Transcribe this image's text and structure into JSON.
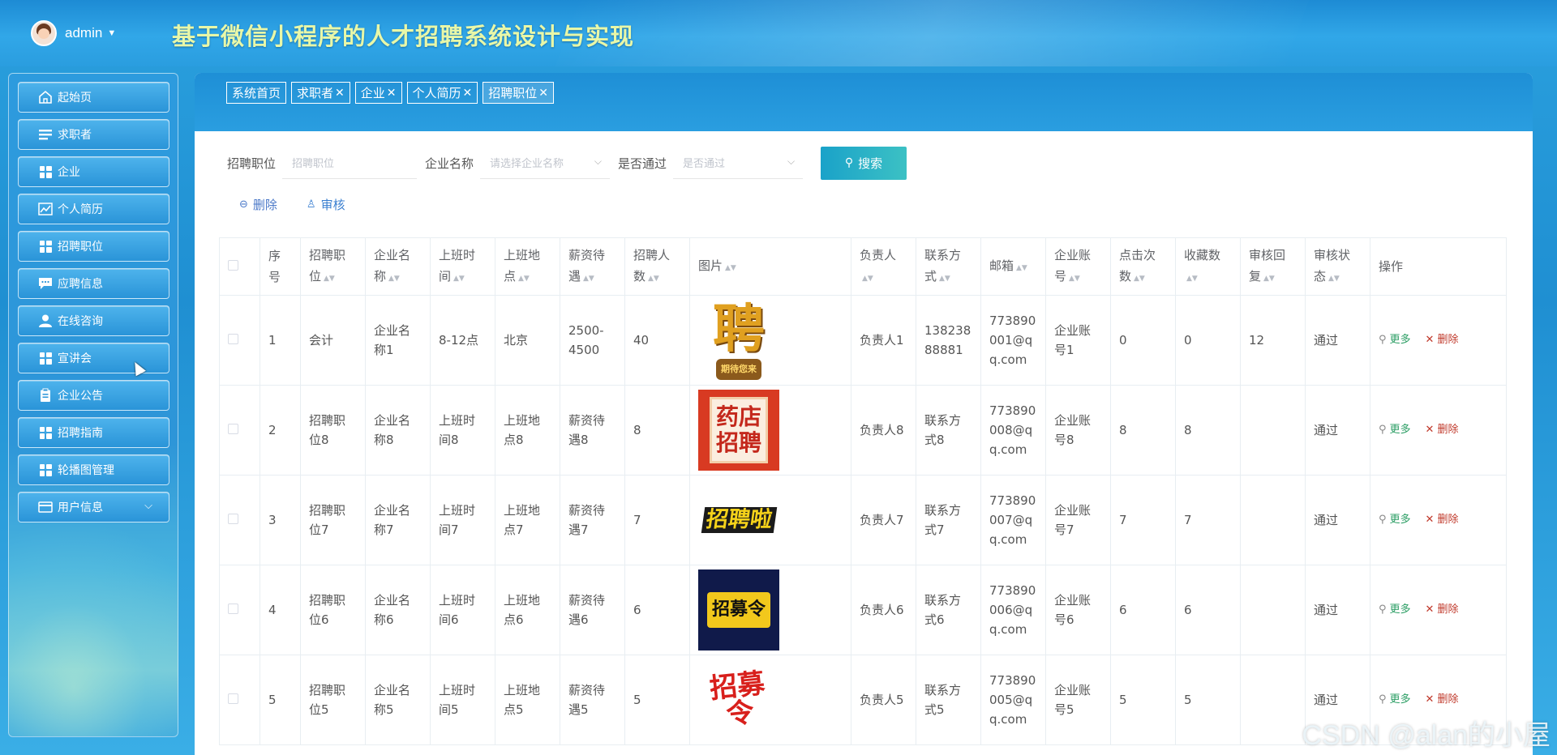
{
  "header": {
    "username": "admin",
    "title": "基于微信小程序的人才招聘系统设计与实现"
  },
  "sidebar": {
    "items": [
      {
        "label": "起始页",
        "icon": "home-icon"
      },
      {
        "label": "求职者",
        "icon": "list-icon"
      },
      {
        "label": "企业",
        "icon": "grid-icon"
      },
      {
        "label": "个人简历",
        "icon": "chart-icon"
      },
      {
        "label": "招聘职位",
        "icon": "grid-icon"
      },
      {
        "label": "应聘信息",
        "icon": "chat-icon"
      },
      {
        "label": "在线咨询",
        "icon": "user-icon"
      },
      {
        "label": "宣讲会",
        "icon": "grid-icon"
      },
      {
        "label": "企业公告",
        "icon": "clipboard-icon"
      },
      {
        "label": "招聘指南",
        "icon": "grid-icon"
      },
      {
        "label": "轮播图管理",
        "icon": "grid-icon"
      },
      {
        "label": "用户信息",
        "icon": "card-icon"
      }
    ]
  },
  "tabs": [
    {
      "label": "系统首页",
      "closable": false
    },
    {
      "label": "求职者",
      "closable": true
    },
    {
      "label": "企业",
      "closable": true
    },
    {
      "label": "个人简历",
      "closable": true
    },
    {
      "label": "招聘职位",
      "closable": true,
      "active": true
    }
  ],
  "search": {
    "field1_label": "招聘职位",
    "field1_placeholder": "招聘职位",
    "field2_label": "企业名称",
    "field2_placeholder": "请选择企业名称",
    "field3_label": "是否通过",
    "field3_placeholder": "是否通过",
    "button": "搜索"
  },
  "actions": {
    "delete": "删除",
    "audit": "审核"
  },
  "table": {
    "headers": [
      "序号",
      "招聘职位",
      "企业名称",
      "上班时间",
      "上班地点",
      "薪资待遇",
      "招聘人数",
      "图片",
      "负责人",
      "联系方式",
      "邮箱",
      "企业账号",
      "点击次数",
      "收藏数",
      "审核回复",
      "审核状态",
      "操作"
    ],
    "more_label": "更多",
    "delete_label": "删除",
    "rows": [
      {
        "no": "1",
        "position": "会计",
        "company": "企业名称1",
        "time": "8-12点",
        "place": "北京",
        "salary": "2500-4500",
        "count": "40",
        "image": "聘",
        "image_sub": "期待您来",
        "owner": "负责人1",
        "contact": "13823888881",
        "email": "773890001@qq.com",
        "account": "企业账号1",
        "clicks": "0",
        "favs": "0",
        "reply": "12",
        "status": "通过"
      },
      {
        "no": "2",
        "position": "招聘职位8",
        "company": "企业名称8",
        "time": "上班时间8",
        "place": "上班地点8",
        "salary": "薪资待遇8",
        "count": "8",
        "image": "药店招聘",
        "owner": "负责人8",
        "contact": "联系方式8",
        "email": "773890008@qq.com",
        "account": "企业账号8",
        "clicks": "8",
        "favs": "8",
        "reply": "",
        "status": "通过"
      },
      {
        "no": "3",
        "position": "招聘职位7",
        "company": "企业名称7",
        "time": "上班时间7",
        "place": "上班地点7",
        "salary": "薪资待遇7",
        "count": "7",
        "image": "招聘啦",
        "owner": "负责人7",
        "contact": "联系方式7",
        "email": "773890007@qq.com",
        "account": "企业账号7",
        "clicks": "7",
        "favs": "7",
        "reply": "",
        "status": "通过"
      },
      {
        "no": "4",
        "position": "招聘职位6",
        "company": "企业名称6",
        "time": "上班时间6",
        "place": "上班地点6",
        "salary": "薪资待遇6",
        "count": "6",
        "image": "招募令",
        "owner": "负责人6",
        "contact": "联系方式6",
        "email": "773890006@qq.com",
        "account": "企业账号6",
        "clicks": "6",
        "favs": "6",
        "reply": "",
        "status": "通过"
      },
      {
        "no": "5",
        "position": "招聘职位5",
        "company": "企业名称5",
        "time": "上班时间5",
        "place": "上班地点5",
        "salary": "薪资待遇5",
        "count": "5",
        "image": "招募令",
        "owner": "负责人5",
        "contact": "联系方式5",
        "email": "773890005@qq.com",
        "account": "企业账号5",
        "clicks": "5",
        "favs": "5",
        "reply": "",
        "status": "通过"
      }
    ]
  },
  "watermark": "CSDN @alan的小屋",
  "colors": {
    "primary": "#2a9ee0",
    "title": "#e8f7a8",
    "search_button": "#2bb3c6",
    "more": "#2a9d63",
    "delete": "#c0392b"
  }
}
